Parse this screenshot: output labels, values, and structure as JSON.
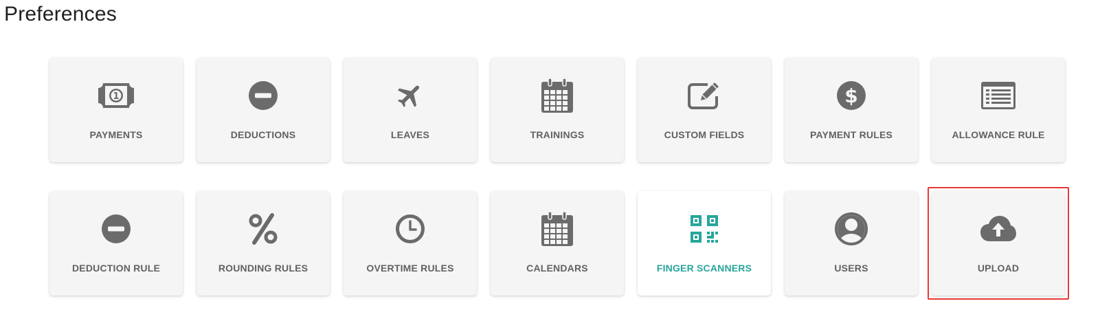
{
  "page": {
    "title": "Preferences"
  },
  "colors": {
    "icon": "#6b6b6b",
    "active": "#26a69a",
    "highlight": "#e53935"
  },
  "tiles": [
    {
      "label": "PAYMENTS",
      "icon": "money-bill-icon"
    },
    {
      "label": "DEDUCTIONS",
      "icon": "minus-circle-icon"
    },
    {
      "label": "LEAVES",
      "icon": "plane-icon"
    },
    {
      "label": "TRAININGS",
      "icon": "calendar-icon"
    },
    {
      "label": "CUSTOM FIELDS",
      "icon": "edit-icon"
    },
    {
      "label": "PAYMENT RULES",
      "icon": "dollar-circle-icon"
    },
    {
      "label": "ALLOWANCE RULE",
      "icon": "list-icon"
    },
    {
      "label": "DEDUCTION RULE",
      "icon": "minus-circle-icon"
    },
    {
      "label": "ROUNDING RULES",
      "icon": "percent-icon"
    },
    {
      "label": "OVERTIME RULES",
      "icon": "clock-icon"
    },
    {
      "label": "CALENDARS",
      "icon": "calendar-icon"
    },
    {
      "label": "FINGER SCANNERS",
      "icon": "qrcode-icon",
      "state": "active"
    },
    {
      "label": "USERS",
      "icon": "user-circle-icon"
    },
    {
      "label": "UPLOAD",
      "icon": "cloud-upload-icon",
      "state": "highlighted"
    }
  ]
}
